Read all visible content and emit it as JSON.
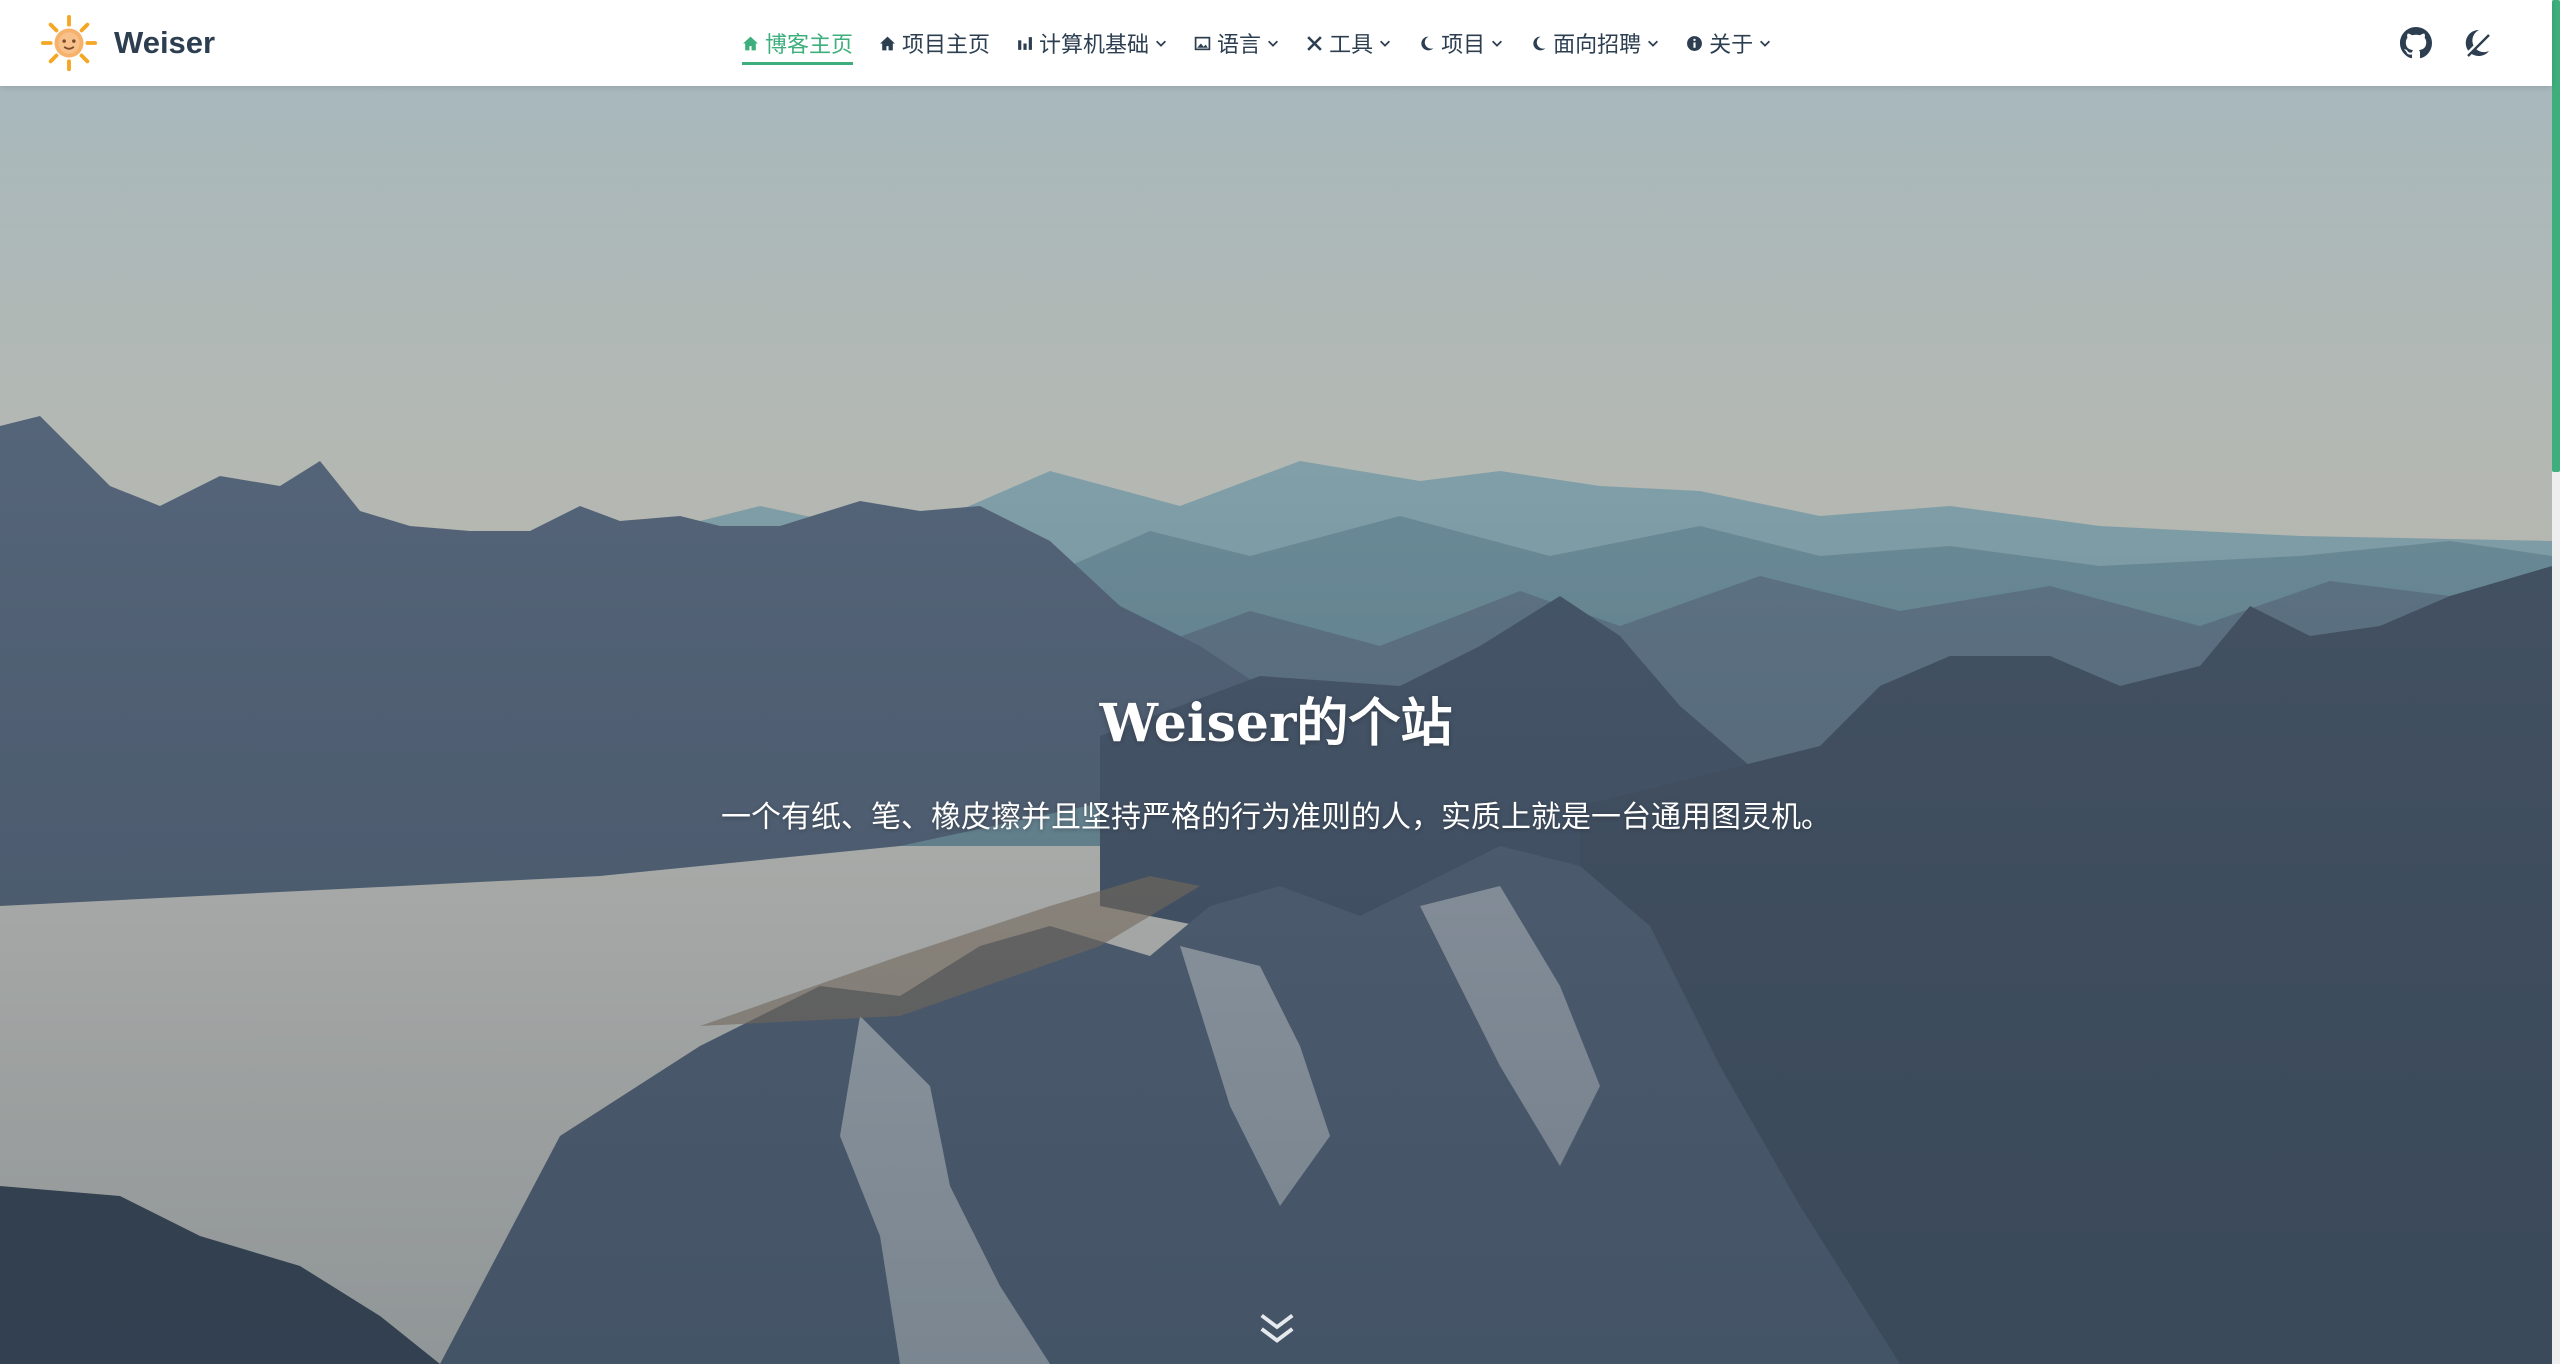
{
  "brand": {
    "name": "Weiser",
    "logo_icon": "sun-logo-icon"
  },
  "nav": {
    "items": [
      {
        "label": "博客主页",
        "icon": "home-icon",
        "active": true,
        "dropdown": false
      },
      {
        "label": "项目主页",
        "icon": "home-icon",
        "active": false,
        "dropdown": false
      },
      {
        "label": "计算机基础",
        "icon": "bar-chart-icon",
        "active": false,
        "dropdown": true
      },
      {
        "label": "语言",
        "icon": "image-icon",
        "active": false,
        "dropdown": true
      },
      {
        "label": "工具",
        "icon": "tools-icon",
        "active": false,
        "dropdown": true
      },
      {
        "label": "项目",
        "icon": "moon-icon",
        "active": false,
        "dropdown": true
      },
      {
        "label": "面向招聘",
        "icon": "moon-icon",
        "active": false,
        "dropdown": true
      },
      {
        "label": "关于",
        "icon": "info-icon",
        "active": false,
        "dropdown": true
      }
    ],
    "right_icons": [
      "github-icon",
      "theme-toggle-icon"
    ]
  },
  "hero": {
    "title": "Weiser的个站",
    "description": "一个有纸、笔、橡皮擦并且坚持严格的行为准则的人，实质上就是一台通用图灵机。",
    "scroll_icon": "chevron-double-down-icon"
  },
  "colors": {
    "accent": "#3eaf7c",
    "text": "#2c3e50"
  }
}
